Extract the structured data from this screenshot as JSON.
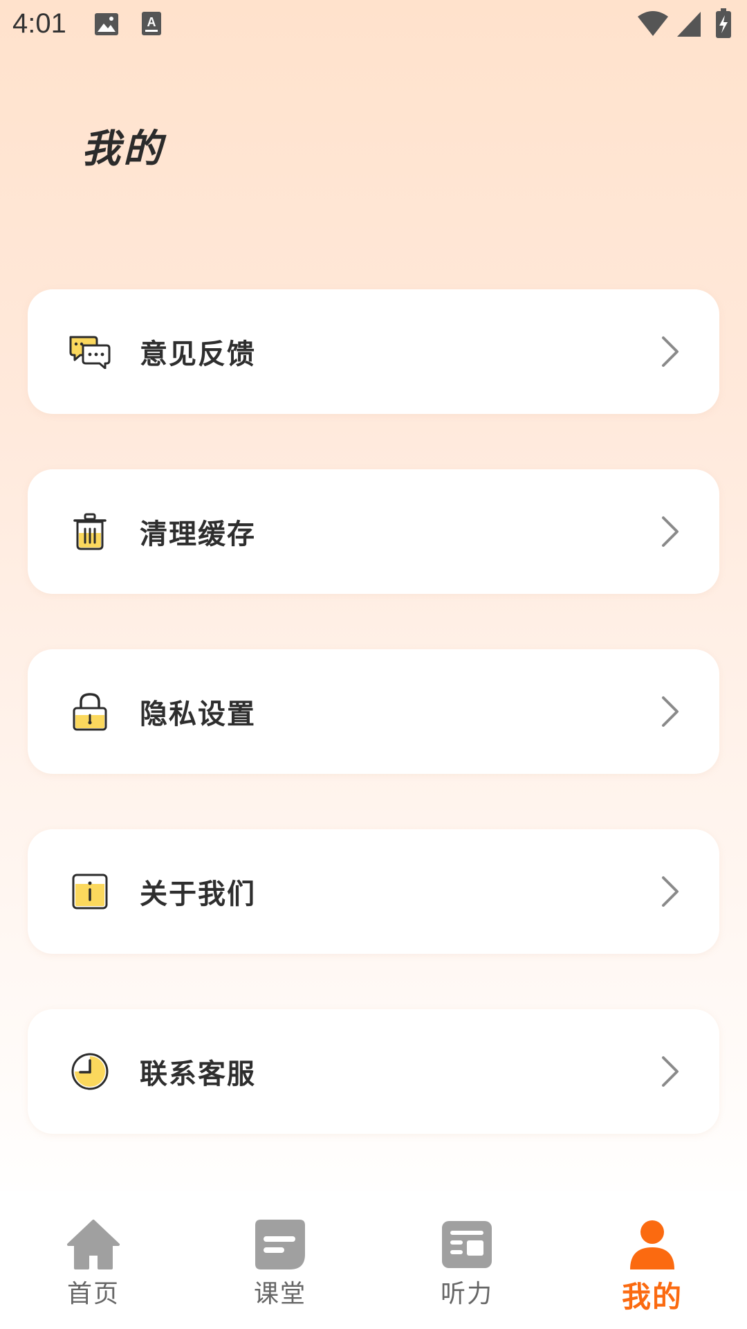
{
  "status_bar": {
    "time": "4:01",
    "icons": [
      "image-icon",
      "keyboard-a-icon",
      "wifi-icon",
      "signal-icon",
      "battery-charging-icon"
    ]
  },
  "page": {
    "title": "我的"
  },
  "menu": {
    "items": [
      {
        "label": "意见反馈",
        "icon": "feedback-chat-icon"
      },
      {
        "label": "清理缓存",
        "icon": "trash-icon"
      },
      {
        "label": "隐私设置",
        "icon": "lock-icon"
      },
      {
        "label": "关于我们",
        "icon": "info-icon"
      },
      {
        "label": "联系客服",
        "icon": "clock-service-icon"
      }
    ]
  },
  "bottom_nav": {
    "items": [
      {
        "label": "首页",
        "icon": "home-icon",
        "active": false
      },
      {
        "label": "课堂",
        "icon": "classroom-icon",
        "active": false
      },
      {
        "label": "听力",
        "icon": "listening-icon",
        "active": false
      },
      {
        "label": "我的",
        "icon": "profile-icon",
        "active": true
      }
    ]
  },
  "colors": {
    "accent": "#fb6a10",
    "icon_yellow": "#fbd85d",
    "icon_outline": "#2b2b2b",
    "nav_inactive": "#a0a0a0",
    "gradient_top": "#ffe2cc"
  }
}
